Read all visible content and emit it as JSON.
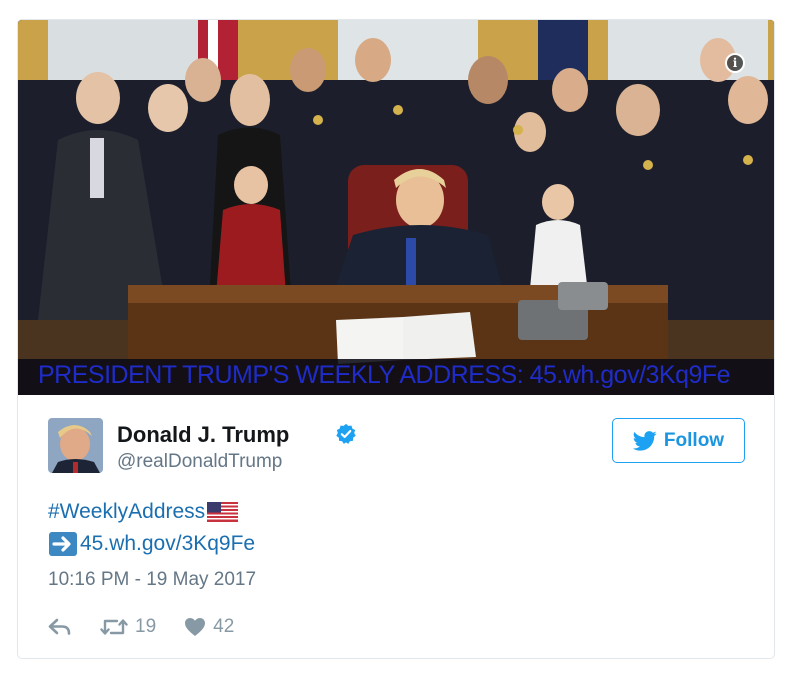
{
  "media": {
    "caption": "PRESIDENT TRUMP'S WEEKLY ADDRESS: 45.wh.gov/3Kq9Fe",
    "info_icon": "info-icon"
  },
  "author": {
    "display_name": "Donald J. Trump",
    "handle": "@realDonaldTrump",
    "verified_icon": "verified-badge-icon"
  },
  "follow_button": {
    "label": "Follow",
    "icon": "twitter-bird-icon"
  },
  "tweet": {
    "hashtag": "#WeeklyAddress",
    "link": "45.wh.gov/3Kq9Fe",
    "hashtag_emoji": "us-flag-icon",
    "link_emoji": "right-arrow-icon"
  },
  "timestamp": "10:16 PM - 19 May 2017",
  "actions": {
    "reply_icon": "reply-icon",
    "retweet_icon": "retweet-icon",
    "retweet_count": "19",
    "like_icon": "heart-icon",
    "like_count": "42"
  },
  "colors": {
    "link": "#1b6fb0",
    "follow_border": "#1da1f2",
    "muted": "#657786",
    "caption": "#1f2cc9"
  }
}
